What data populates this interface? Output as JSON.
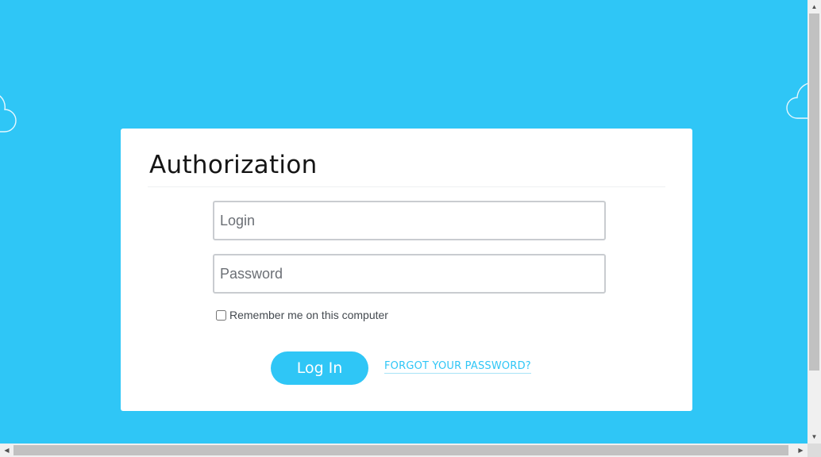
{
  "page": {
    "background_color": "#2fc6f6"
  },
  "form": {
    "title": "Authorization",
    "login": {
      "placeholder": "Login",
      "value": ""
    },
    "password": {
      "placeholder": "Password",
      "value": ""
    },
    "remember": {
      "label": "Remember me on this computer",
      "checked": false
    },
    "submit_label": "Log In",
    "forgot_label": "FORGOT YOUR PASSWORD?",
    "accent_color": "#2fc6f6"
  },
  "icons": {
    "cloud_left": "cloud-icon",
    "cloud_right": "cloud-icon",
    "scroll_up": "triangle-up",
    "scroll_down": "triangle-down",
    "scroll_left": "triangle-left",
    "scroll_right": "triangle-right"
  }
}
